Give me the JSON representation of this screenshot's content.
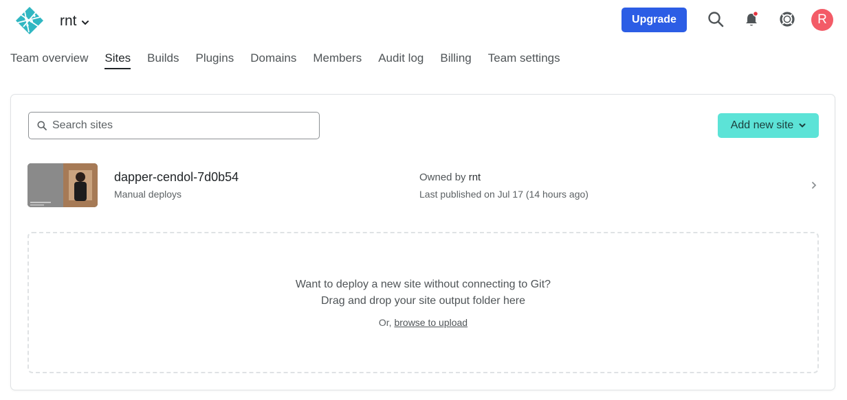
{
  "header": {
    "team_name": "rnt",
    "upgrade_label": "Upgrade",
    "avatar_initial": "R",
    "notification_dot_color": "#e5323e"
  },
  "tabs": [
    {
      "label": "Team overview",
      "active": false
    },
    {
      "label": "Sites",
      "active": true
    },
    {
      "label": "Builds",
      "active": false
    },
    {
      "label": "Plugins",
      "active": false
    },
    {
      "label": "Domains",
      "active": false
    },
    {
      "label": "Members",
      "active": false
    },
    {
      "label": "Audit log",
      "active": false
    },
    {
      "label": "Billing",
      "active": false
    },
    {
      "label": "Team settings",
      "active": false
    }
  ],
  "sites_panel": {
    "search_placeholder": "Search sites",
    "add_site_label": "Add new site",
    "sites": [
      {
        "name": "dapper-cendol-7d0b54",
        "deploy_type": "Manual deploys",
        "owned_by_prefix": "Owned by",
        "owner": "rnt",
        "last_published": "Last published on Jul 17 (14 hours ago)"
      }
    ],
    "dropzone": {
      "line1": "Want to deploy a new site without connecting to Git?",
      "line2": "Drag and drop your site output folder here",
      "or_prefix": "Or,",
      "browse_link": "browse to upload"
    }
  },
  "colors": {
    "brand_primary": "#2c5de5",
    "accent_teal": "#5ce3d7",
    "avatar_bg": "#f35b67",
    "logo_teal": "#30b7c2"
  }
}
